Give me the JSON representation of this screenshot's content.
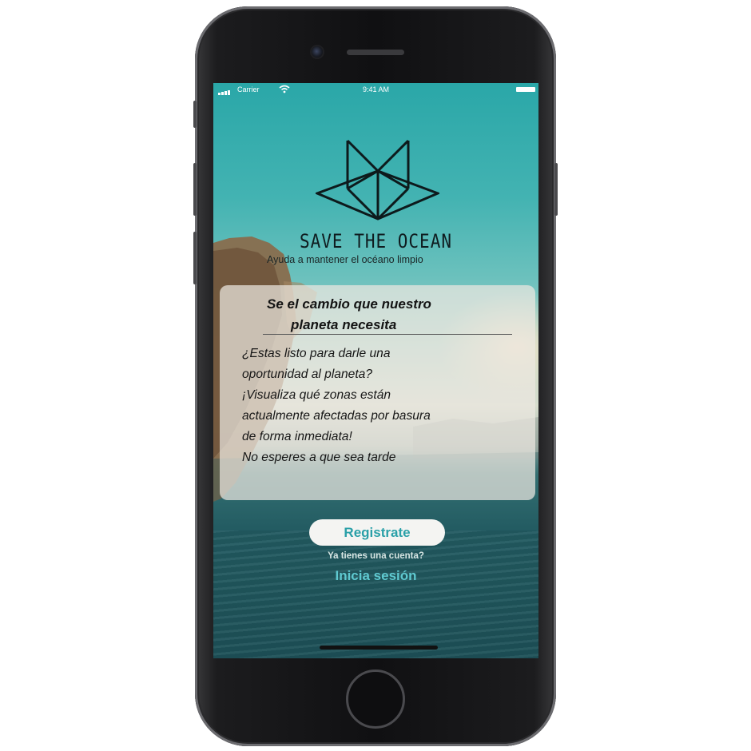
{
  "status_bar": {
    "carrier": "Carrier",
    "time": "9:41 AM",
    "icons": [
      "signal-icon",
      "wifi-icon",
      "battery-icon"
    ]
  },
  "app": {
    "brand": "SAVE THE OCEAN",
    "tagline": "Ayuda a mantener el océano limpio",
    "logo_icon": "geometric-cat-logo"
  },
  "card": {
    "title_lines": [
      "Se el cambio que nuestro",
      "planeta necesita"
    ],
    "body_lines": [
      "¿Estas listo para darle una",
      "oportunidad al planeta?",
      "¡Visualiza qué zonas están",
      "actualmente afectadas por basura",
      "de forma inmediata!",
      "No esperes a que sea tarde"
    ]
  },
  "actions": {
    "register_label": "Registrate",
    "have_account_text": "Ya tienes una cuenta?",
    "login_label": "Inicia sesión"
  },
  "colors": {
    "accent": "#2aa0a8",
    "login_link": "#5fc9d0",
    "card_bg": "#ece8e0"
  }
}
